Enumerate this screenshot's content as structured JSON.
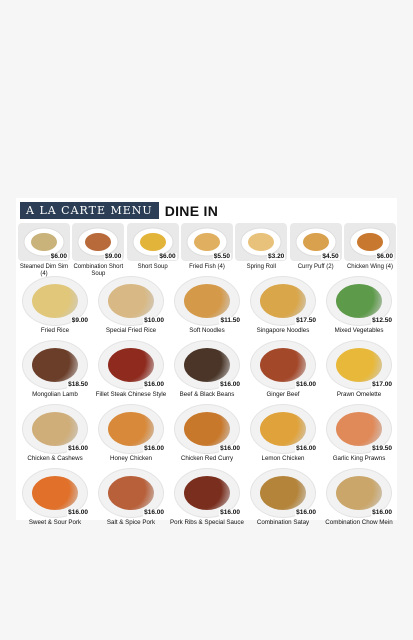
{
  "header": {
    "badge": "A LA CARTE MENU",
    "title": "DINE IN"
  },
  "small_items": [
    {
      "label": "Steamed Dim Sim (4)",
      "price": "$6.00",
      "color": "#c9b37a"
    },
    {
      "label": "Combination Short Soup",
      "price": "$9.00",
      "color": "#b86a3a"
    },
    {
      "label": "Short Soup",
      "price": "$6.00",
      "color": "#e3b43a"
    },
    {
      "label": "Fried Fish (4)",
      "price": "$5.50",
      "color": "#e0b060"
    },
    {
      "label": "Spring Roll",
      "price": "$3.20",
      "color": "#e8c27a"
    },
    {
      "label": "Curry Puff (2)",
      "price": "$4.50",
      "color": "#d9a04e"
    },
    {
      "label": "Chicken Wing (4)",
      "price": "$6.00",
      "color": "#c9782f"
    }
  ],
  "dishes": [
    {
      "label": "Fried Rice",
      "price": "$9.00",
      "color": "#e0c77a"
    },
    {
      "label": "Special Fried Rice",
      "price": "$10.00",
      "color": "#d8b985"
    },
    {
      "label": "Soft Noodles",
      "price": "$11.50",
      "color": "#d49a4a"
    },
    {
      "label": "Singapore Noodles",
      "price": "$17.50",
      "color": "#d9a64a"
    },
    {
      "label": "Mixed Vegetables",
      "price": "$12.50",
      "color": "#5d9a4a"
    },
    {
      "label": "Mongolian Lamb",
      "price": "$18.50",
      "color": "#6b3e2a"
    },
    {
      "label": "Fillet Steak Chinese Style",
      "price": "$16.00",
      "color": "#8e2a1e"
    },
    {
      "label": "Beef & Black Beans",
      "price": "$16.00",
      "color": "#4a3528"
    },
    {
      "label": "Ginger Beef",
      "price": "$16.00",
      "color": "#a4482a"
    },
    {
      "label": "Prawn Omelette",
      "price": "$17.00",
      "color": "#e7b83a"
    },
    {
      "label": "Chicken & Cashews",
      "price": "$16.00",
      "color": "#cfae7a"
    },
    {
      "label": "Honey Chicken",
      "price": "$16.00",
      "color": "#d8893a"
    },
    {
      "label": "Chicken Red Curry",
      "price": "$16.00",
      "color": "#c8782a"
    },
    {
      "label": "Lemon Chicken",
      "price": "$16.00",
      "color": "#e0a23a"
    },
    {
      "label": "Garlic King Prawns",
      "price": "$19.50",
      "color": "#e08a5a"
    },
    {
      "label": "Sweet & Sour Pork",
      "price": "$16.00",
      "color": "#e0702a"
    },
    {
      "label": "Salt & Spice Pork",
      "price": "$16.00",
      "color": "#b8603a"
    },
    {
      "label": "Pork Ribs & Special Sauce",
      "price": "$16.00",
      "color": "#7a2e1e"
    },
    {
      "label": "Combination Satay",
      "price": "$16.00",
      "color": "#b4843a"
    },
    {
      "label": "Combination Chow Mein",
      "price": "$16.00",
      "color": "#caa66a"
    }
  ]
}
